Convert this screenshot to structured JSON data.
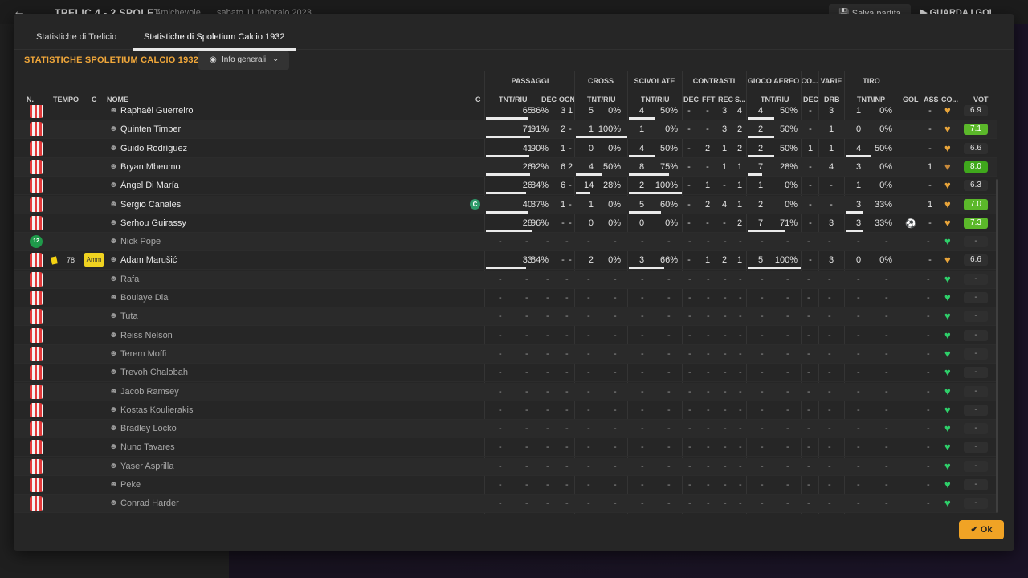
{
  "background": {
    "back_icon": "arrow-left-icon",
    "score": "TRELIC  4 - 2  SPOLET",
    "match_type": "Amichevole",
    "match_date": "sabato 11 febbraio 2023",
    "save_label": "Salva partita",
    "watch_label": "GUARDA I GOL"
  },
  "tabs": [
    {
      "label": "Statistiche di Trelicio",
      "active": false
    },
    {
      "label": "Statistiche di Spoletium Calcio 1932",
      "active": true
    }
  ],
  "section_title": "STATISTICHE SPOLETIUM CALCIO 1932",
  "view_dropdown": {
    "label": "Info generali",
    "icon": "eye-icon"
  },
  "column_groups": [
    "PASSAGGI",
    "CROSS",
    "SCIVOLATE",
    "CONTRASTI",
    "GIOCO AEREO",
    "CO...",
    "VARIE",
    "TIRO"
  ],
  "columns": {
    "num": "N.",
    "time": "TEMPO",
    "c": "C",
    "name": "NOME",
    "c2": "C",
    "pass_tr": "TNT/RIU",
    "pass_dec": "DEC",
    "pass_ocn": "OCN",
    "cross_tr": "TNT/RIU",
    "slide_tr": "TNT/RIU",
    "con_dec": "DEC",
    "con_fft": "FFT",
    "con_rec": "REC",
    "con_s": "S...",
    "air_tr": "TNT/RIU",
    "co_dec": "DEC",
    "var_drb": "DRB",
    "shot_tr": "TNT\\INP",
    "gol": "GOL",
    "ass": "ASS",
    "co": "CO...",
    "vot": "VOT"
  },
  "players": [
    {
      "name": "Raphaël Guerreiro",
      "shirt": "",
      "time": "",
      "pass_t": "65",
      "pass_r": "86%",
      "pass_dec": "3",
      "pass_ocn": "1",
      "cross_t": "5",
      "cross_r": "0%",
      "slide_t": "4",
      "slide_r": "50%",
      "con_dec": "-",
      "con_fft": "-",
      "con_rec": "3",
      "con_s": "4",
      "air_t": "4",
      "air_r": "50%",
      "co_dec": "-",
      "drb": "3",
      "shot_t": "1",
      "shot_r": "0%",
      "gol": "",
      "ass": "-",
      "vote": "6.9",
      "vote_color": "",
      "heart_color": "#e9a53a",
      "active": true,
      "pass_bar": 0.86,
      "cross_bar": 0,
      "slide_bar": 0.5,
      "air_bar": 0.5,
      "shot_bar": 0
    },
    {
      "name": "Quinten Timber",
      "shirt": "",
      "time": "",
      "pass_t": "71",
      "pass_r": "91%",
      "pass_dec": "2",
      "pass_ocn": "-",
      "cross_t": "1",
      "cross_r": "100%",
      "slide_t": "1",
      "slide_r": "0%",
      "con_dec": "-",
      "con_fft": "-",
      "con_rec": "3",
      "con_s": "2",
      "air_t": "2",
      "air_r": "50%",
      "co_dec": "-",
      "drb": "1",
      "shot_t": "0",
      "shot_r": "0%",
      "gol": "",
      "ass": "-",
      "vote": "7.1",
      "vote_color": "#5bb82a",
      "heart_color": "#e9a53a",
      "active": true,
      "pass_bar": 0.91,
      "cross_bar": 1,
      "slide_bar": 0,
      "air_bar": 0.5,
      "shot_bar": 0
    },
    {
      "name": "Guido Rodríguez",
      "shirt": "",
      "time": "",
      "pass_t": "41",
      "pass_r": "90%",
      "pass_dec": "1",
      "pass_ocn": "-",
      "cross_t": "0",
      "cross_r": "0%",
      "slide_t": "4",
      "slide_r": "50%",
      "con_dec": "-",
      "con_fft": "2",
      "con_rec": "1",
      "con_s": "2",
      "air_t": "2",
      "air_r": "50%",
      "co_dec": "1",
      "drb": "1",
      "shot_t": "4",
      "shot_r": "50%",
      "gol": "",
      "ass": "-",
      "vote": "6.6",
      "vote_color": "",
      "heart_color": "#e9a53a",
      "active": true,
      "pass_bar": 0.9,
      "cross_bar": 0,
      "slide_bar": 0.5,
      "air_bar": 0.5,
      "shot_bar": 0.5
    },
    {
      "name": "Bryan Mbeumo",
      "shirt": "",
      "time": "",
      "pass_t": "26",
      "pass_r": "92%",
      "pass_dec": "6",
      "pass_ocn": "2",
      "cross_t": "4",
      "cross_r": "50%",
      "slide_t": "8",
      "slide_r": "75%",
      "con_dec": "-",
      "con_fft": "-",
      "con_rec": "1",
      "con_s": "1",
      "air_t": "7",
      "air_r": "28%",
      "co_dec": "-",
      "drb": "4",
      "shot_t": "3",
      "shot_r": "0%",
      "gol": "",
      "ass": "1",
      "vote": "8.0",
      "vote_color": "#3fa81c",
      "heart_color": "#c98a3a",
      "active": true,
      "pass_bar": 0.92,
      "cross_bar": 0.5,
      "slide_bar": 0.75,
      "air_bar": 0.28,
      "shot_bar": 0
    },
    {
      "name": "Ángel Di María",
      "shirt": "",
      "time": "",
      "pass_t": "26",
      "pass_r": "84%",
      "pass_dec": "6",
      "pass_ocn": "-",
      "cross_t": "14",
      "cross_r": "28%",
      "slide_t": "2",
      "slide_r": "100%",
      "con_dec": "-",
      "con_fft": "1",
      "con_rec": "-",
      "con_s": "1",
      "air_t": "1",
      "air_r": "0%",
      "co_dec": "-",
      "drb": "-",
      "shot_t": "1",
      "shot_r": "0%",
      "gol": "",
      "ass": "-",
      "vote": "6.3",
      "vote_color": "",
      "heart_color": "#e9a53a",
      "active": true,
      "pass_bar": 0.84,
      "cross_bar": 0.28,
      "slide_bar": 1,
      "air_bar": 0,
      "shot_bar": 0
    },
    {
      "name": "Sergio Canales",
      "shirt": "",
      "time": "",
      "pass_t": "40",
      "pass_r": "87%",
      "pass_dec": "1",
      "pass_ocn": "-",
      "cross_t": "1",
      "cross_r": "0%",
      "slide_t": "5",
      "slide_r": "60%",
      "con_dec": "-",
      "con_fft": "2",
      "con_rec": "4",
      "con_s": "1",
      "air_t": "2",
      "air_r": "0%",
      "co_dec": "-",
      "drb": "-",
      "shot_t": "3",
      "shot_r": "33%",
      "gol": "",
      "ass": "1",
      "vote": "7.0",
      "vote_color": "#5bb82a",
      "heart_color": "#e9a53a",
      "active": true,
      "captain": true,
      "pass_bar": 0.87,
      "cross_bar": 0,
      "slide_bar": 0.6,
      "air_bar": 0,
      "shot_bar": 0.33
    },
    {
      "name": "Serhou Guirassy",
      "shirt": "",
      "time": "",
      "pass_t": "28",
      "pass_r": "96%",
      "pass_dec": "-",
      "pass_ocn": "-",
      "cross_t": "0",
      "cross_r": "0%",
      "slide_t": "0",
      "slide_r": "0%",
      "con_dec": "-",
      "con_fft": "-",
      "con_rec": "-",
      "con_s": "2",
      "air_t": "7",
      "air_r": "71%",
      "co_dec": "-",
      "drb": "3",
      "shot_t": "3",
      "shot_r": "33%",
      "gol": "ball",
      "ass": "-",
      "vote": "7.3",
      "vote_color": "#5bb82a",
      "heart_color": "#e9a53a",
      "active": true,
      "pass_bar": 0.96,
      "cross_bar": 0,
      "slide_bar": 0,
      "air_bar": 0.71,
      "shot_bar": 0.33
    },
    {
      "name": "Nick Pope",
      "shirt": "12",
      "time": "",
      "gk": true,
      "active": false,
      "heart_color": "#2ed06a",
      "vote": "-"
    },
    {
      "name": "Adam Marušić",
      "shirt": "",
      "time": "78",
      "yellow": true,
      "amm": "Amm",
      "pass_t": "33",
      "pass_r": "84%",
      "pass_dec": "-",
      "pass_ocn": "-",
      "cross_t": "2",
      "cross_r": "0%",
      "slide_t": "3",
      "slide_r": "66%",
      "con_dec": "-",
      "con_fft": "1",
      "con_rec": "2",
      "con_s": "1",
      "air_t": "5",
      "air_r": "100%",
      "co_dec": "-",
      "drb": "3",
      "shot_t": "0",
      "shot_r": "0%",
      "gol": "",
      "ass": "-",
      "vote": "6.6",
      "vote_color": "",
      "heart_color": "#e9a53a",
      "active": true,
      "pass_bar": 0.84,
      "cross_bar": 0,
      "slide_bar": 0.66,
      "air_bar": 1,
      "shot_bar": 0
    },
    {
      "name": "Rafa",
      "active": false,
      "heart_color": "#2ed06a",
      "vote": "-"
    },
    {
      "name": "Boulaye Dia",
      "active": false,
      "heart_color": "#2ed06a",
      "vote": "-"
    },
    {
      "name": "Tuta",
      "active": false,
      "heart_color": "#2ed06a",
      "vote": "-"
    },
    {
      "name": "Reiss Nelson",
      "active": false,
      "heart_color": "#2ed06a",
      "vote": "-"
    },
    {
      "name": "Terem Moffi",
      "active": false,
      "heart_color": "#2ed06a",
      "vote": "-"
    },
    {
      "name": "Trevoh Chalobah",
      "active": false,
      "heart_color": "#2ed06a",
      "vote": "-"
    },
    {
      "name": "Jacob Ramsey",
      "active": false,
      "heart_color": "#2ed06a",
      "vote": "-"
    },
    {
      "name": "Kostas Koulierakis",
      "active": false,
      "heart_color": "#2ed06a",
      "vote": "-"
    },
    {
      "name": "Bradley Locko",
      "active": false,
      "heart_color": "#2ed06a",
      "vote": "-"
    },
    {
      "name": "Nuno Tavares",
      "active": false,
      "heart_color": "#2ed06a",
      "vote": "-"
    },
    {
      "name": "Yaser Asprilla",
      "active": false,
      "heart_color": "#2ed06a",
      "vote": "-"
    },
    {
      "name": "Peke",
      "active": false,
      "heart_color": "#2ed06a",
      "vote": "-"
    },
    {
      "name": "Conrad Harder",
      "active": false,
      "heart_color": "#2ed06a",
      "vote": "-"
    }
  ],
  "ok_label": "Ok",
  "ok_icon": "check-icon",
  "colors": {
    "accent": "#f0a73a",
    "ok_button": "#f0a325",
    "vote_good": "#5bb82a",
    "vote_great": "#3fa81c",
    "fitness_full": "#2ed06a",
    "fitness_tired": "#e9a53a"
  }
}
